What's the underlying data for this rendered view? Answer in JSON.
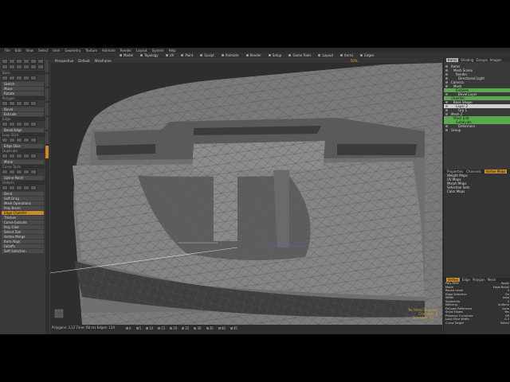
{
  "menubar": {
    "items": [
      "File",
      "Edit",
      "View",
      "Select",
      "Item",
      "Geometry",
      "Texture",
      "Animate",
      "Render",
      "Layout",
      "System",
      "Help"
    ]
  },
  "modes": [
    "Model",
    "Topology",
    "UV",
    "Paint",
    "Sculpt",
    "Animate",
    "Render",
    "Setup",
    "Game Tools",
    "Layout",
    "Items",
    "Edges"
  ],
  "toolbox": {
    "sections": [
      {
        "title": "Basic",
        "buttons": [
          "Sketch",
          "Move",
          "Rotate"
        ]
      },
      {
        "title": "Polygon",
        "buttons": [
          "Bevel",
          "Extrude"
        ]
      },
      {
        "title": "Edge",
        "buttons": [
          "Bevel Edge"
        ]
      },
      {
        "title": "Loop Slice",
        "buttons": [
          "Edge Slice"
        ]
      },
      {
        "title": "Duplicate",
        "buttons": [
          "Mirror"
        ]
      },
      {
        "title": "Curve Tools",
        "buttons": [
          "Spline Patch"
        ]
      },
      {
        "title": "Deform",
        "buttons": [
          "Bend",
          "Soft Drag"
        ]
      }
    ],
    "lower": [
      "Mesh Operations",
      "Poly Bevel",
      "Edge Chamfer",
      "Thicken",
      "Curve Extrude",
      "Poly Fillet",
      "Select Tool",
      "Vertex Merge",
      "Item Align",
      "Falloffs",
      "Soft Selection"
    ],
    "highlight": "Edge Chamfer"
  },
  "viewport": {
    "tabs": [
      "Perspective",
      "Default",
      "Wireframe"
    ],
    "zoom": "50%",
    "info_lines": [
      "No Items Selected",
      "Channels: 0",
      "Polygons: 68 ..."
    ]
  },
  "status": {
    "line": "Polygons: 3,12   Time: 68 ms   Edges: 134",
    "timeline": [
      "0",
      "5",
      "10",
      "15",
      "20",
      "25",
      "30",
      "35",
      "40",
      "45"
    ]
  },
  "items_panel": {
    "tabs": [
      "Items",
      "Shading",
      "Groups",
      "Images"
    ],
    "rows": [
      {
        "label": "Items",
        "state": "normal"
      },
      {
        "label": "Mesh Scene",
        "state": "normal"
      },
      {
        "label": "Render",
        "state": "normal"
      },
      {
        "label": "Directional Light",
        "state": "normal"
      },
      {
        "label": "Camera",
        "state": "normal"
      },
      {
        "label": "Mesh",
        "state": "normal"
      },
      {
        "label": "Emblem",
        "state": "green"
      },
      {
        "label": "Bevel Layer",
        "state": "normal"
      },
      {
        "label": "Chamfer",
        "state": "green"
      },
      {
        "label": "Base Shape",
        "state": "normal"
      },
      {
        "label": "Layer 2",
        "state": "sel"
      },
      {
        "label": "Grp 1",
        "state": "normal"
      },
      {
        "label": "Mesh 2",
        "state": "normal"
      },
      {
        "label": "Mesh Edit",
        "state": "green"
      },
      {
        "label": "Subdivide",
        "state": "green"
      },
      {
        "label": "Deformers",
        "state": "normal"
      },
      {
        "label": "Group",
        "state": "normal"
      }
    ]
  },
  "mid_panel": {
    "tabs": [
      "Properties",
      "Channels",
      "Vertex Maps"
    ],
    "rows": [
      "Weight Maps",
      "UV Maps",
      "Morph Maps",
      "Selection Sets",
      "Color Maps"
    ]
  },
  "prop_panel": {
    "tabs": [
      "Vertex",
      "Edge",
      "Polygon",
      "Mesh"
    ],
    "rows": [
      {
        "k": "Poly Fillet",
        "v": "Apply"
      },
      {
        "k": "Mode",
        "v": "Edge Bevel"
      },
      {
        "k": "Round Level",
        "v": "0"
      },
      {
        "k": "Edge Selection",
        "v": "On"
      },
      {
        "k": "Width",
        "v": "Auto"
      },
      {
        "k": "Segments",
        "v": "2"
      },
      {
        "k": "Mitering",
        "v": "Uniform"
      },
      {
        "k": "Polygon Reference",
        "v": "none"
      },
      {
        "k": "Show Edges",
        "v": "Yes"
      },
      {
        "k": "Preserve Curvature",
        "v": "Off"
      },
      {
        "k": "Loop Slice Width",
        "v": "0.2"
      },
      {
        "k": "Curve Target",
        "v": "Select"
      }
    ]
  },
  "colors": {
    "accent": "#c88a2a",
    "selected_green": "#5aa84e",
    "mesh": "#7c7c7c",
    "wire": "#4f4f4f"
  }
}
